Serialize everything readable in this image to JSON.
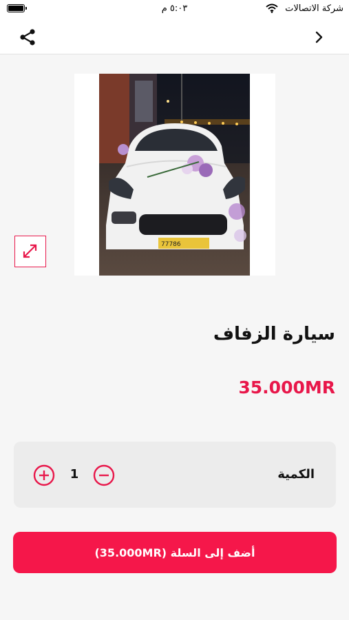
{
  "status_bar": {
    "carrier": "شركة الاتصالات",
    "time": "٥:٠٣ م",
    "icons": [
      "battery-icon",
      "wifi-icon"
    ]
  },
  "nav": {
    "icons": [
      "share-icon",
      "chevron-right-icon"
    ]
  },
  "product": {
    "image_icon": "product-photo",
    "expand_icon": "expand-icon",
    "title": "سيارة الزفاف",
    "price": "35.000MR"
  },
  "quantity": {
    "label": "الكمية",
    "value": "1",
    "icons": [
      "plus-circle-icon",
      "minus-circle-icon"
    ]
  },
  "cart_button": {
    "label": "أضف إلى السلة (35.000MR)"
  },
  "colors": {
    "accent": "#f5174a",
    "price": "#e8174a",
    "background": "#f6f6f6",
    "card": "#ececec"
  }
}
